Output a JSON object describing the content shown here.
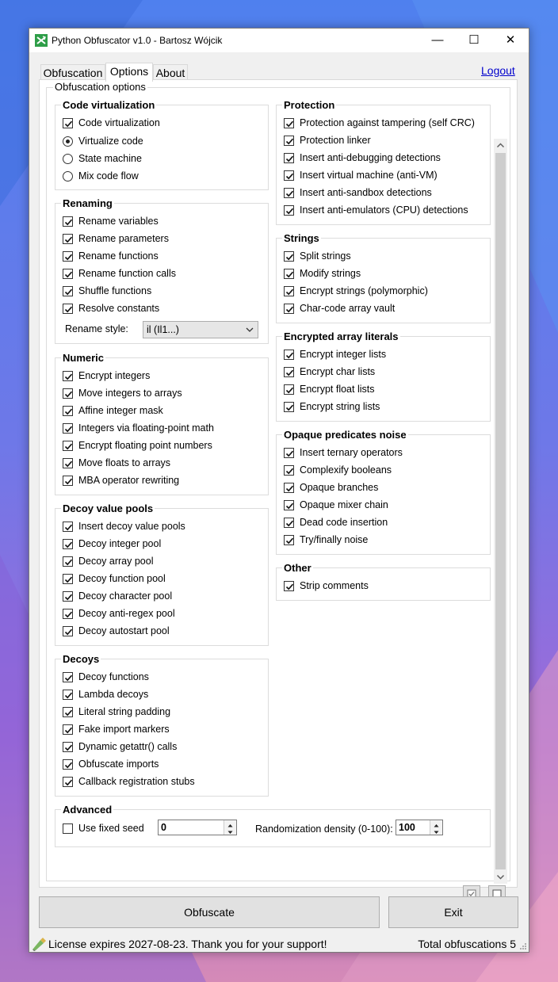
{
  "window": {
    "title": "Python Obfuscator v1.0 - Bartosz Wójcik",
    "minimize": "—",
    "maximize": "☐",
    "close": "✕"
  },
  "tabs": [
    {
      "label": "Obfuscation"
    },
    {
      "label": "Options",
      "active": true
    },
    {
      "label": "About"
    }
  ],
  "logout_label": "Logout",
  "options_group_label": "Obfuscation options",
  "groups": {
    "code_virtualization": {
      "title": "Code virtualization",
      "checkbox": {
        "label": "Code virtualization",
        "checked": true
      },
      "radios": [
        {
          "label": "Virtualize code",
          "selected": true
        },
        {
          "label": "State machine",
          "selected": false
        },
        {
          "label": "Mix code flow",
          "selected": false
        }
      ]
    },
    "renaming": {
      "title": "Renaming",
      "items": [
        {
          "label": "Rename variables",
          "checked": true
        },
        {
          "label": "Rename parameters",
          "checked": true
        },
        {
          "label": "Rename functions",
          "checked": true
        },
        {
          "label": "Rename function calls",
          "checked": true
        },
        {
          "label": "Shuffle functions",
          "checked": true
        },
        {
          "label": "Resolve constants",
          "checked": true
        }
      ],
      "style_label": "Rename style:",
      "style_value": "il (Il1...)"
    },
    "numeric": {
      "title": "Numeric",
      "items": [
        {
          "label": "Encrypt integers",
          "checked": true
        },
        {
          "label": "Move integers to arrays",
          "checked": true
        },
        {
          "label": "Affine integer mask",
          "checked": true
        },
        {
          "label": "Integers via floating-point math",
          "checked": true
        },
        {
          "label": "Encrypt floating point numbers",
          "checked": true
        },
        {
          "label": "Move floats to arrays",
          "checked": true
        },
        {
          "label": "MBA operator rewriting",
          "checked": true
        }
      ]
    },
    "decoy_pools": {
      "title": "Decoy value pools",
      "items": [
        {
          "label": "Insert decoy value pools",
          "checked": true
        },
        {
          "label": "Decoy integer pool",
          "checked": true
        },
        {
          "label": "Decoy array pool",
          "checked": true
        },
        {
          "label": "Decoy function pool",
          "checked": true
        },
        {
          "label": "Decoy character pool",
          "checked": true
        },
        {
          "label": "Decoy anti-regex pool",
          "checked": true
        },
        {
          "label": "Decoy autostart pool",
          "checked": true
        }
      ]
    },
    "decoys": {
      "title": "Decoys",
      "items": [
        {
          "label": "Decoy functions",
          "checked": true
        },
        {
          "label": "Lambda decoys",
          "checked": true
        },
        {
          "label": "Literal string padding",
          "checked": true
        },
        {
          "label": "Fake import markers",
          "checked": true
        },
        {
          "label": "Dynamic getattr() calls",
          "checked": true
        },
        {
          "label": "Obfuscate imports",
          "checked": true
        },
        {
          "label": "Callback registration stubs",
          "checked": true
        }
      ]
    },
    "protection": {
      "title": "Protection",
      "items": [
        {
          "label": "Protection against tampering (self CRC)",
          "checked": true
        },
        {
          "label": "Protection linker",
          "checked": true
        },
        {
          "label": "Insert anti-debugging detections",
          "checked": true
        },
        {
          "label": "Insert virtual machine (anti-VM)",
          "checked": true
        },
        {
          "label": "Insert anti-sandbox detections",
          "checked": true
        },
        {
          "label": "Insert anti-emulators (CPU) detections",
          "checked": true
        }
      ]
    },
    "strings": {
      "title": "Strings",
      "items": [
        {
          "label": "Split strings",
          "checked": true
        },
        {
          "label": "Modify strings",
          "checked": true
        },
        {
          "label": "Encrypt strings (polymorphic)",
          "checked": true
        },
        {
          "label": "Char-code array vault",
          "checked": true
        }
      ]
    },
    "array_literals": {
      "title": "Encrypted array literals",
      "items": [
        {
          "label": "Encrypt integer lists",
          "checked": true
        },
        {
          "label": "Encrypt char lists",
          "checked": true
        },
        {
          "label": "Encrypt float lists",
          "checked": true
        },
        {
          "label": "Encrypt string lists",
          "checked": true
        }
      ]
    },
    "opaque": {
      "title": "Opaque predicates  noise",
      "items": [
        {
          "label": "Insert ternary operators",
          "checked": true
        },
        {
          "label": "Complexify booleans",
          "checked": true
        },
        {
          "label": "Opaque branches",
          "checked": true
        },
        {
          "label": "Opaque mixer chain",
          "checked": true
        },
        {
          "label": "Dead code insertion",
          "checked": true
        },
        {
          "label": "Try/finally noise",
          "checked": true
        }
      ]
    },
    "other": {
      "title": "Other",
      "items": [
        {
          "label": "Strip comments",
          "checked": true
        }
      ]
    },
    "advanced": {
      "title": "Advanced",
      "fixed_seed": {
        "label": "Use fixed seed",
        "checked": false
      },
      "seed_value": "0",
      "density_label": "Randomization density (0-100):",
      "density_value": "100"
    }
  },
  "buttons": {
    "obfuscate": "Obfuscate",
    "exit": "Exit"
  },
  "status": {
    "license": "License expires 2027-08-23. Thank you for your support!",
    "total": "Total obfuscations 5"
  }
}
